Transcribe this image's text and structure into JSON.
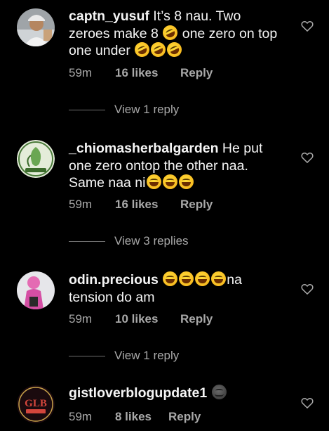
{
  "comments": [
    {
      "username": "captn_yusuf",
      "text": " It’s 8 nau. Two zeroes make 8 ",
      "text2": " one zero on top one under ",
      "time": "59m",
      "likes": "16 likes",
      "reply": "Reply",
      "view_replies": "View 1 reply",
      "avatar_icon": "user-photo-avatar"
    },
    {
      "username": "_chiomasherbalgarden",
      "text": " He put one zero ontop the other naa. Same naa ni",
      "time": "59m",
      "likes": "16 likes",
      "reply": "Reply",
      "view_replies": "View 3 replies",
      "avatar_icon": "herbal-logo-avatar"
    },
    {
      "username": "odin.precious",
      "text": "na tension do am",
      "time": "59m",
      "likes": "10 likes",
      "reply": "Reply",
      "view_replies": "View 1 reply",
      "avatar_icon": "pink-figure-avatar"
    },
    {
      "username": "gistloverblogupdate1",
      "text": "",
      "time": "59m",
      "likes": "8 likes",
      "reply": "Reply",
      "avatar_icon": "glb-logo-avatar",
      "avatar_text": "GLB"
    }
  ],
  "colors": {
    "background": "#000000",
    "text": "#f5f5f5",
    "muted": "#a8a8a8"
  },
  "icons": {
    "like": "heart-outline-icon",
    "laugh": "rolling-laughing-emoji",
    "grin": "grinning-squinting-emoji",
    "dark_face": "dark-face-emoji"
  }
}
